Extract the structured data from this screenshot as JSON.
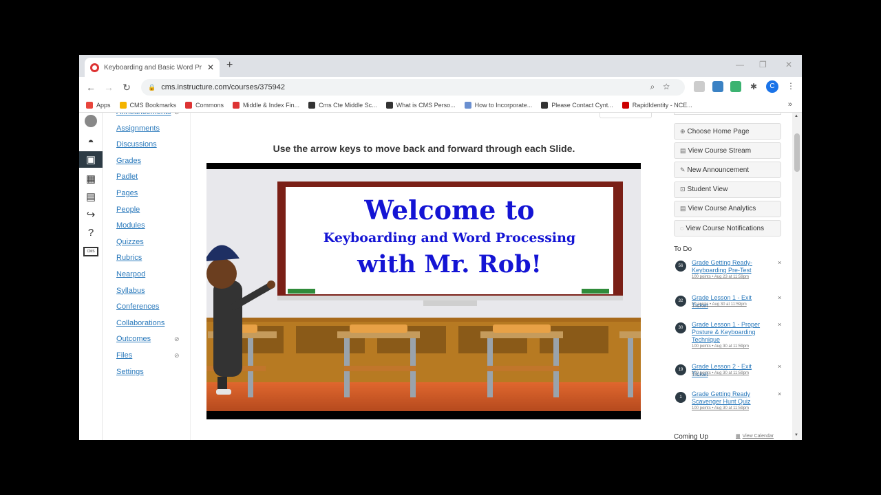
{
  "browser": {
    "tab_title": "Keyboarding and Basic Word Pr",
    "tab_close": "✕",
    "new_tab": "+",
    "url": "cms.instructure.com/courses/375942",
    "profile_initial": "C"
  },
  "bookmarks": [
    {
      "label": "Apps",
      "icon_color": "#e8453c"
    },
    {
      "label": "CMS Bookmarks",
      "icon_color": "#f4b400"
    },
    {
      "label": "Commons",
      "icon_color": "#d33"
    },
    {
      "label": "Middle & Index Fin...",
      "icon_color": "#d33"
    },
    {
      "label": "Cms Cte Middle Sc...",
      "icon_color": "#333"
    },
    {
      "label": "What is CMS Perso...",
      "icon_color": "#333"
    },
    {
      "label": "How to Incorporate...",
      "icon_color": "#6a8fd0"
    },
    {
      "label": "Please Contact Cynt...",
      "icon_color": "#333"
    },
    {
      "label": "RapidIdentity - NCE...",
      "icon_color": "#c00"
    }
  ],
  "course_nav": [
    {
      "label": "Announcements",
      "hidden_icon": true
    },
    {
      "label": "Assignments",
      "hidden_icon": false
    },
    {
      "label": "Discussions",
      "hidden_icon": false
    },
    {
      "label": "Grades",
      "hidden_icon": false
    },
    {
      "label": "Padlet",
      "hidden_icon": false
    },
    {
      "label": "Pages",
      "hidden_icon": false
    },
    {
      "label": "People",
      "hidden_icon": false
    },
    {
      "label": "Modules",
      "hidden_icon": false
    },
    {
      "label": "Quizzes",
      "hidden_icon": false
    },
    {
      "label": "Rubrics",
      "hidden_icon": false
    },
    {
      "label": "Nearpod",
      "hidden_icon": false
    },
    {
      "label": "Syllabus",
      "hidden_icon": false
    },
    {
      "label": "Conferences",
      "hidden_icon": false
    },
    {
      "label": "Collaborations",
      "hidden_icon": false
    },
    {
      "label": "Outcomes",
      "hidden_icon": true
    },
    {
      "label": "Files",
      "hidden_icon": true
    },
    {
      "label": "Settings",
      "hidden_icon": false
    }
  ],
  "content": {
    "instruction": "Use the arrow keys to move back and forward through each Slide.",
    "slide": {
      "line1": "Welcome to",
      "line2": "Keyboarding and Word Processing",
      "line3": "with Mr. Rob!"
    }
  },
  "sidebar_buttons": [
    {
      "label": "Choose Home Page",
      "icon": "⊕"
    },
    {
      "label": "View Course Stream",
      "icon": "▤"
    },
    {
      "label": "New Announcement",
      "icon": "✎"
    },
    {
      "label": "Student View",
      "icon": "⊡"
    },
    {
      "label": "View Course Analytics",
      "icon": "▤"
    },
    {
      "label": "View Course Notifications",
      "icon": "◌"
    }
  ],
  "todo": {
    "title": "To Do",
    "items": [
      {
        "badge": "56",
        "title": "Grade Getting Ready- Keyboarding Pre-Test",
        "meta": "100 points • Aug 23 at 11:59pm"
      },
      {
        "badge": "32",
        "title": "Grade Lesson 1 - Exit Ticket",
        "meta": "10 points • Aug 30 at 11:59pm"
      },
      {
        "badge": "30",
        "title": "Grade Lesson 1 - Proper Posture & Keyboarding Technique",
        "meta": "100 points • Aug 30 at 11:59pm"
      },
      {
        "badge": "19",
        "title": "Grade Lesson 2 - Exit Ticket",
        "meta": "100 points • Aug 30 at 11:59pm"
      },
      {
        "badge": "1",
        "title": "Grade Getting Ready Scavenger Hunt Quiz",
        "meta": "100 points • Aug 30 at 11:59pm"
      }
    ],
    "dismiss": "×"
  },
  "coming_up": {
    "title": "Coming Up",
    "view_calendar": "View Calendar"
  },
  "annotation_tools": [
    "pause-icon",
    "pointer-icon",
    "pen-icon",
    "highlighter-icon",
    "close-icon"
  ]
}
